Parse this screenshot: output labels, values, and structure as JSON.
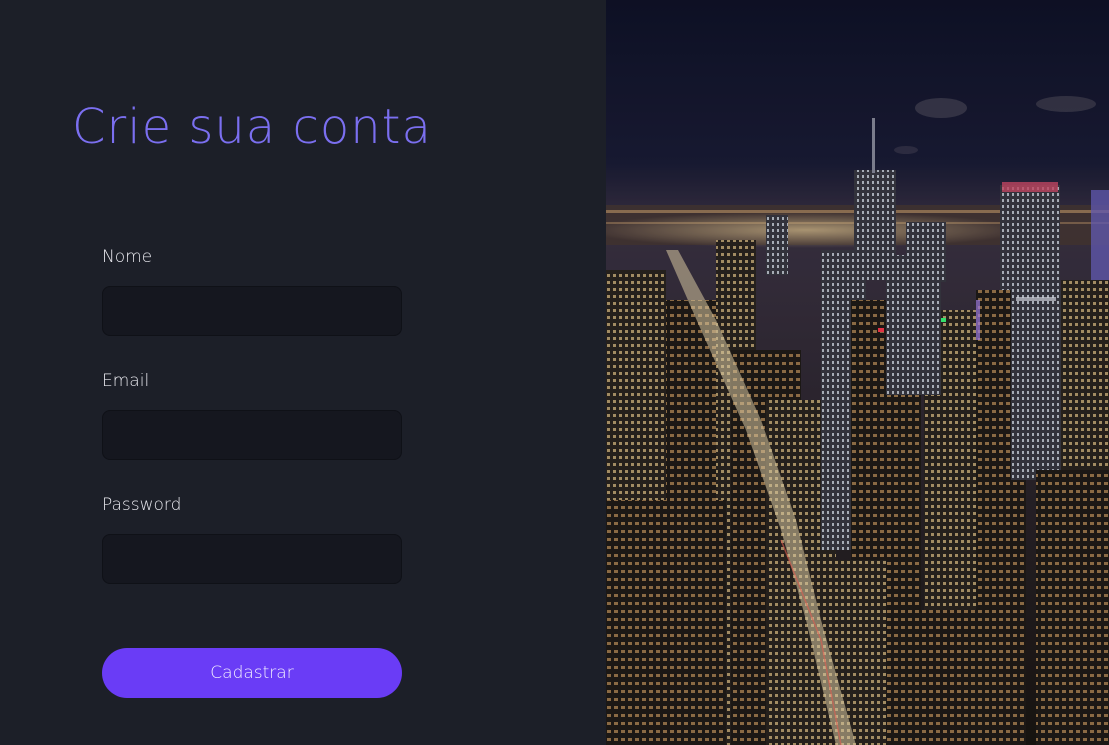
{
  "form": {
    "title": "Crie sua conta",
    "fields": [
      {
        "label": "Nome",
        "value": "",
        "placeholder": ""
      },
      {
        "label": "Email",
        "value": "",
        "placeholder": ""
      },
      {
        "label": "Password",
        "value": "",
        "placeholder": ""
      }
    ],
    "submit_label": "Cadastrar"
  },
  "hero_image": {
    "subject": "night-city-skyline-photo"
  },
  "colors": {
    "background": "#1c1f28",
    "title": "#7b6ff0",
    "input_background": "#15171f",
    "button": "#6a3cf6",
    "label_text": "#e8e8ee"
  }
}
